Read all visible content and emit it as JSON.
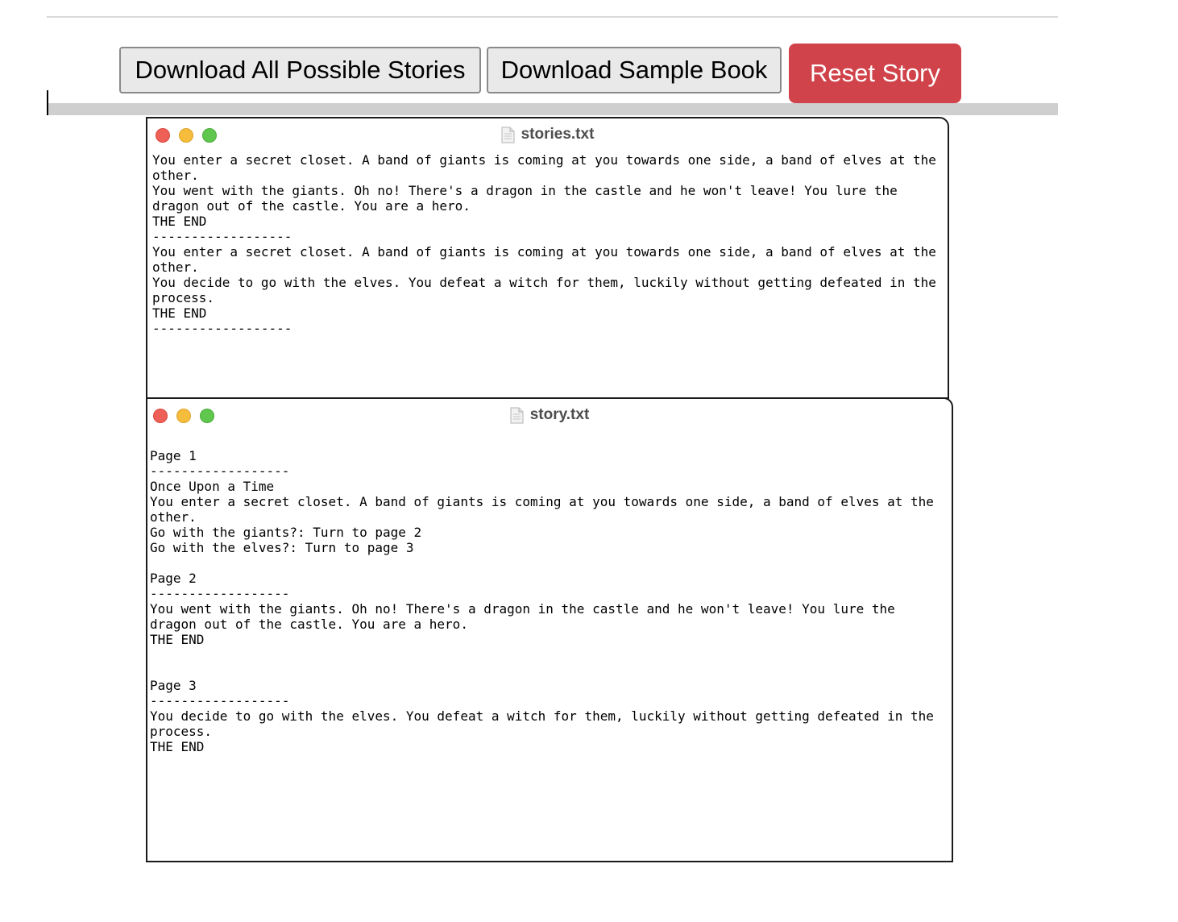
{
  "toolbar": {
    "download_all_label": "Download All Possible Stories",
    "download_sample_label": "Download Sample Book",
    "reset_label": "Reset Story"
  },
  "colors": {
    "reset_button": "#d1434b",
    "traffic_red": "#ed5f57",
    "traffic_yellow": "#f5bd3b",
    "traffic_green": "#5fc74d"
  },
  "windows": [
    {
      "title": "stories.txt",
      "icon": "document-icon",
      "content": "You enter a secret closet. A band of giants is coming at you towards one side, a band of elves at the\nother.\nYou went with the giants. Oh no! There's a dragon in the castle and he won't leave! You lure the\ndragon out of the castle. You are a hero.\nTHE END\n------------------\nYou enter a secret closet. A band of giants is coming at you towards one side, a band of elves at the\nother.\nYou decide to go with the elves. You defeat a witch for them, luckily without getting defeated in the\nprocess.\nTHE END\n------------------"
    },
    {
      "title": "story.txt",
      "icon": "document-icon",
      "content": "Page 1\n------------------\nOnce Upon a Time\nYou enter a secret closet. A band of giants is coming at you towards one side, a band of elves at the\nother.\nGo with the giants?: Turn to page 2\nGo with the elves?: Turn to page 3\n\nPage 2\n------------------\nYou went with the giants. Oh no! There's a dragon in the castle and he won't leave! You lure the\ndragon out of the castle. You are a hero.\nTHE END\n\n\nPage 3\n------------------\nYou decide to go with the elves. You defeat a witch for them, luckily without getting defeated in the\nprocess.\nTHE END"
    }
  ]
}
